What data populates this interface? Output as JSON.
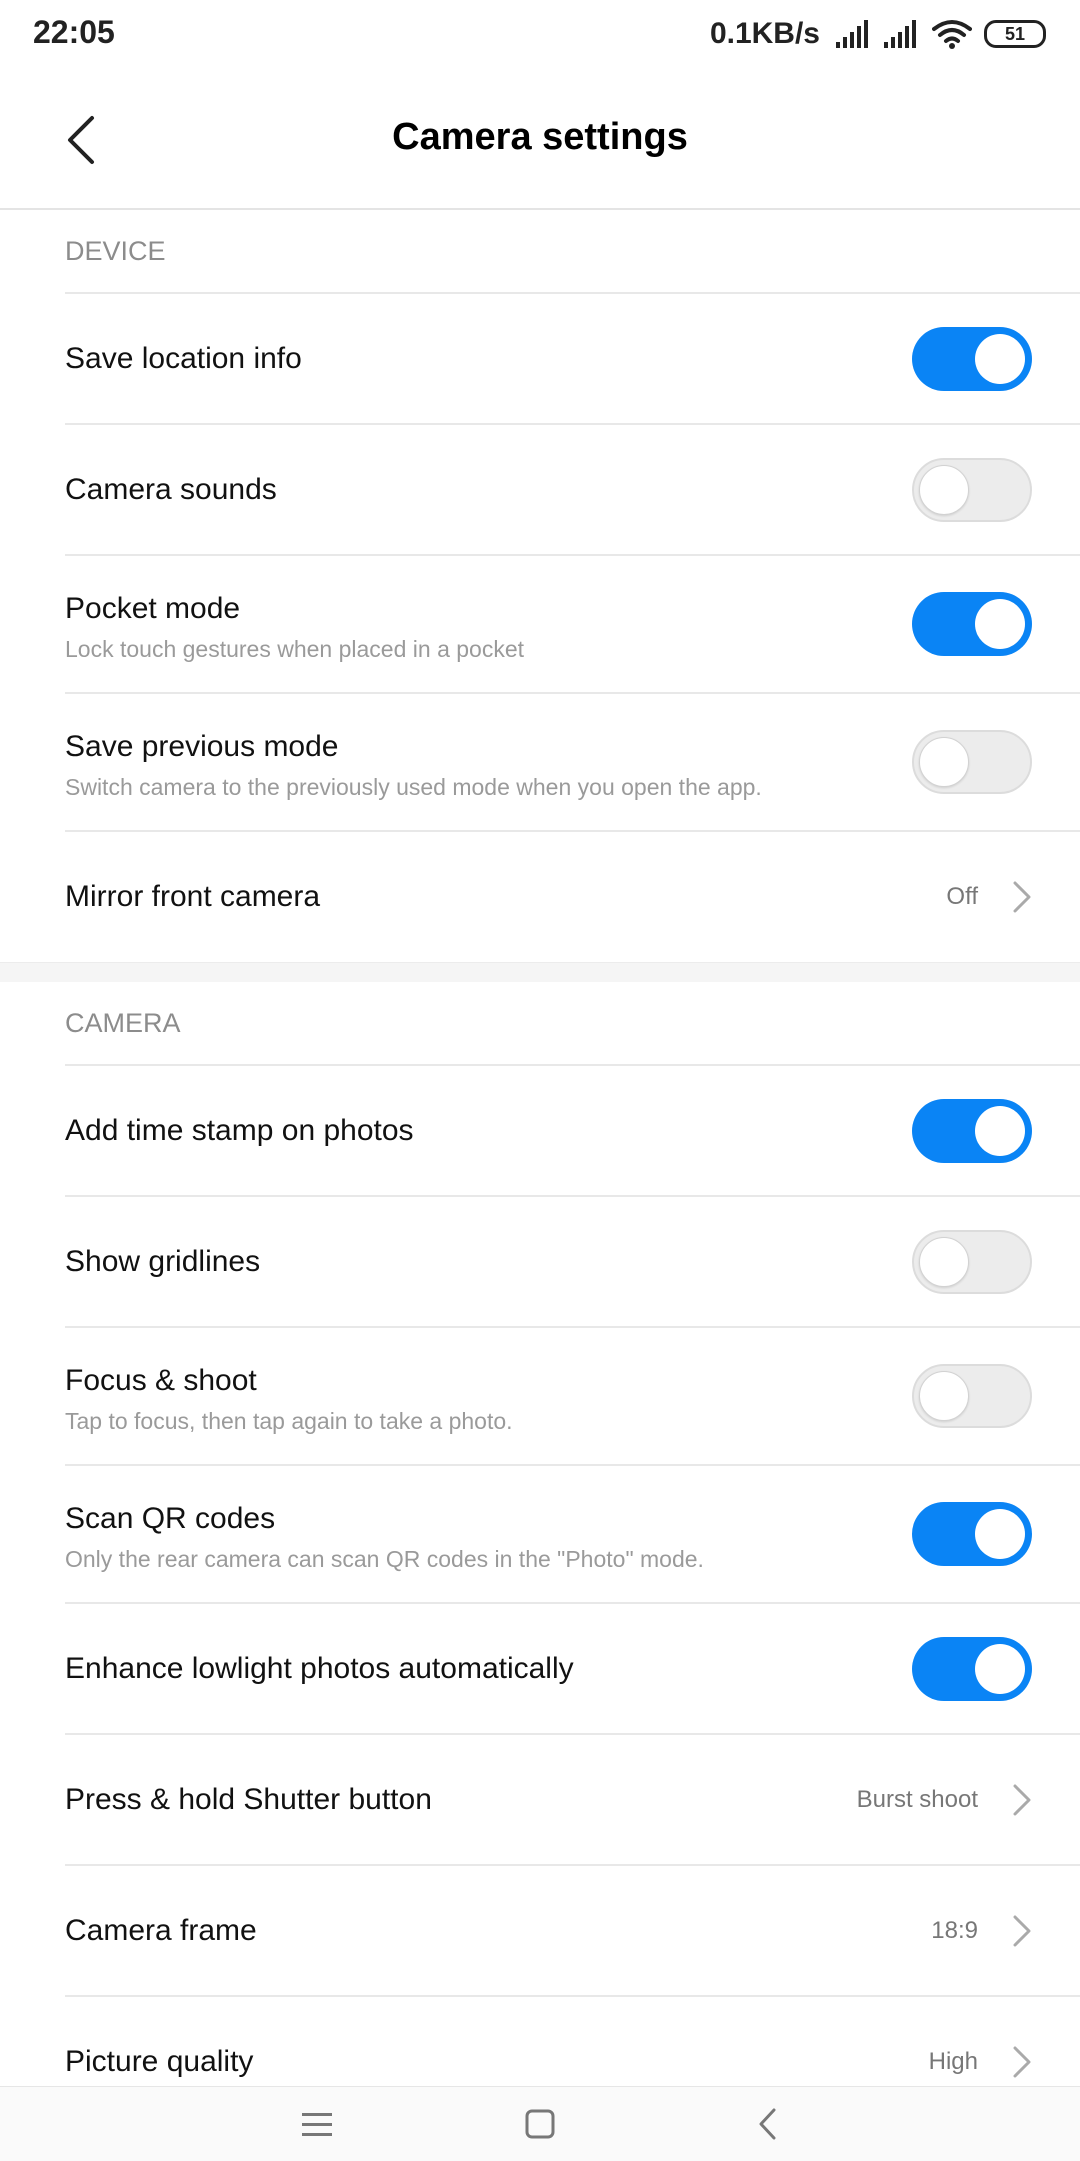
{
  "status_bar": {
    "time": "22:05",
    "net_speed": "0.1KB/s",
    "battery": "51",
    "icons": [
      "signal-icon",
      "signal-icon",
      "wifi-icon",
      "battery-icon"
    ]
  },
  "header": {
    "title": "Camera settings",
    "back_icon": "back-arrow-icon"
  },
  "device": {
    "header": "DEVICE",
    "save_location": {
      "title": "Save location info",
      "on": true
    },
    "camera_sounds": {
      "title": "Camera sounds",
      "on": false
    },
    "pocket_mode": {
      "title": "Pocket mode",
      "subtitle": "Lock touch gestures when placed in a pocket",
      "on": true
    },
    "save_previous": {
      "title": "Save previous mode",
      "subtitle": "Switch camera to the previously used mode when you open the app.",
      "on": false
    },
    "mirror_front": {
      "title": "Mirror front camera",
      "value": "Off"
    }
  },
  "camera": {
    "header": "CAMERA",
    "time_stamp": {
      "title": "Add time stamp on photos",
      "on": true
    },
    "gridlines": {
      "title": "Show gridlines",
      "on": false
    },
    "focus_shoot": {
      "title": "Focus & shoot",
      "subtitle": "Tap to focus, then tap again to take a photo.",
      "on": false
    },
    "scan_qr": {
      "title": "Scan QR codes",
      "subtitle": "Only the rear camera can scan QR codes in the \"Photo\" mode.",
      "on": true
    },
    "lowlight": {
      "title": "Enhance lowlight photos automatically",
      "on": true
    },
    "press_hold": {
      "title": "Press & hold Shutter button",
      "value": "Burst shoot"
    },
    "camera_frame": {
      "title": "Camera frame",
      "value": "18:9"
    },
    "picture_quality": {
      "title": "Picture quality",
      "value": "High"
    }
  },
  "nav": {
    "icons": [
      "menu-icon",
      "home-icon",
      "back-icon"
    ]
  },
  "colors": {
    "accent": "#0a84f5",
    "toggle_off": "#ececec"
  }
}
